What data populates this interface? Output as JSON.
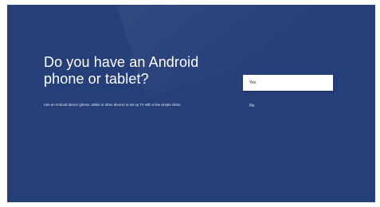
{
  "setup": {
    "title": "Do you have an Android phone or tablet?",
    "subtitle": "Use an Android device (phone, tablet or other device) to set up TV with a few simple clicks.",
    "options": [
      {
        "label": "Yes",
        "selected": true
      },
      {
        "label": "No",
        "selected": false
      }
    ]
  },
  "colors": {
    "background": "#263f78",
    "selected_option_bg": "#ffffff",
    "text": "#ffffff"
  }
}
